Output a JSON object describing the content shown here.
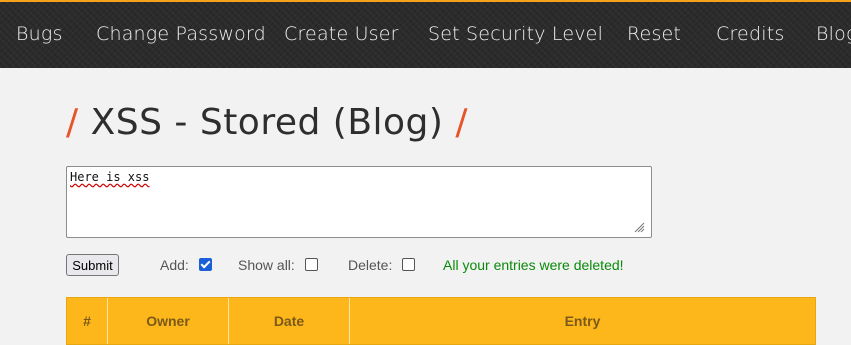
{
  "nav": {
    "items": [
      {
        "label": "Bugs"
      },
      {
        "label": "Change Password"
      },
      {
        "label": "Create User"
      },
      {
        "label": "Set Security Level"
      },
      {
        "label": "Reset"
      },
      {
        "label": "Credits"
      },
      {
        "label": "Blog"
      }
    ]
  },
  "page": {
    "title": "XSS - Stored (Blog)",
    "slash": "/"
  },
  "form": {
    "entry_text": "Here is xss",
    "submit_label": "Submit",
    "add_label": "Add:",
    "add_checked": true,
    "show_all_label": "Show all:",
    "show_all_checked": false,
    "delete_label": "Delete:",
    "delete_checked": false,
    "status_message": "All your entries were deleted!"
  },
  "table": {
    "columns": [
      "#",
      "Owner",
      "Date",
      "Entry"
    ]
  },
  "colors": {
    "accent": "#e8542a",
    "nav_bg": "#2b2b2b",
    "table_header": "#fdb71a",
    "status_green": "#0a8a0a"
  }
}
